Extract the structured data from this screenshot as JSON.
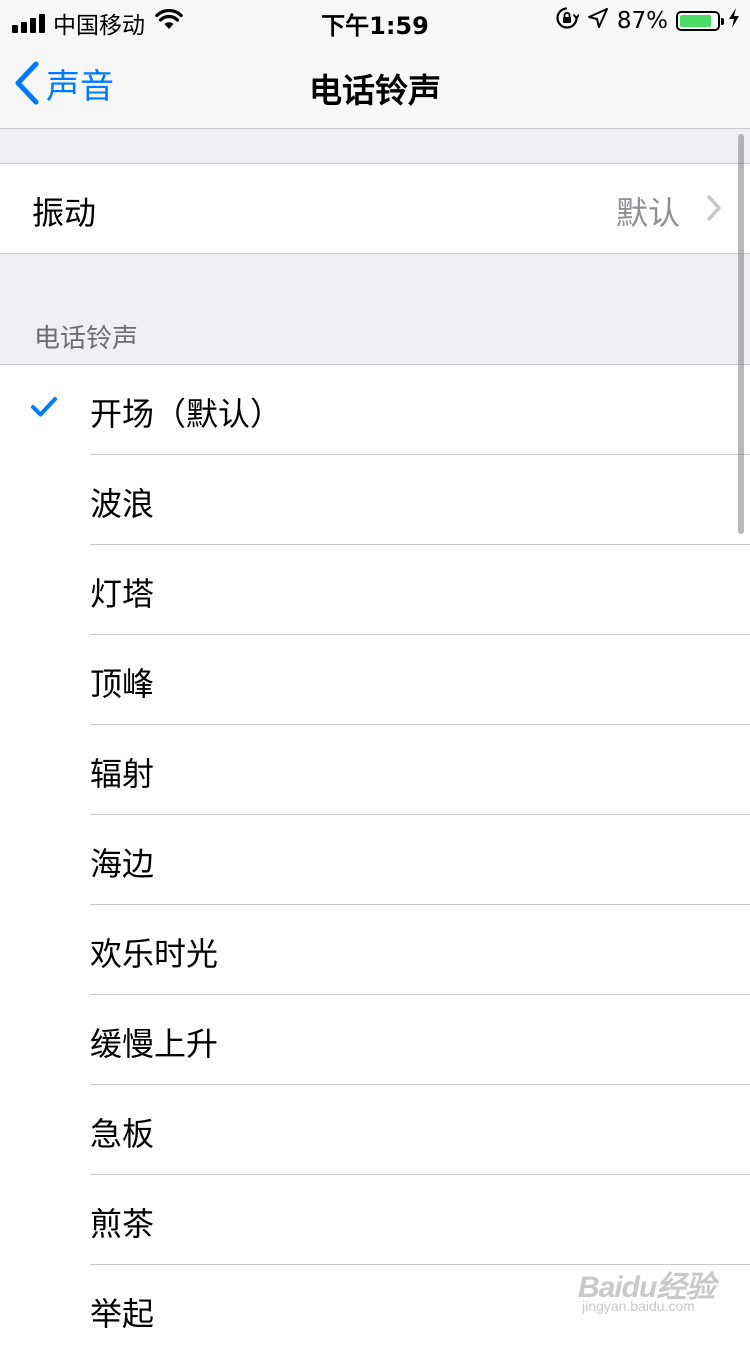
{
  "status_bar": {
    "carrier": "中国移动",
    "time": "下午1:59",
    "battery_percent": "87%",
    "battery_level": 0.87,
    "icons": [
      "signal-icon",
      "wifi-icon",
      "orientation-lock-icon",
      "location-icon",
      "battery-icon",
      "charging-icon"
    ]
  },
  "nav": {
    "back_label": "声音",
    "title": "电话铃声"
  },
  "vibration": {
    "label": "振动",
    "value": "默认"
  },
  "ringtones": {
    "header": "电话铃声",
    "items": [
      "开场（默认）",
      "波浪",
      "灯塔",
      "顶峰",
      "辐射",
      "海边",
      "欢乐时光",
      "缓慢上升",
      "急板",
      "煎茶",
      "举起"
    ],
    "selected_index": 0
  },
  "watermark": {
    "brand": "Baidu经验",
    "url": "jingyan.baidu.com"
  },
  "colors": {
    "accent": "#007aff",
    "battery": "#4cd964",
    "background": "#efeff4"
  }
}
